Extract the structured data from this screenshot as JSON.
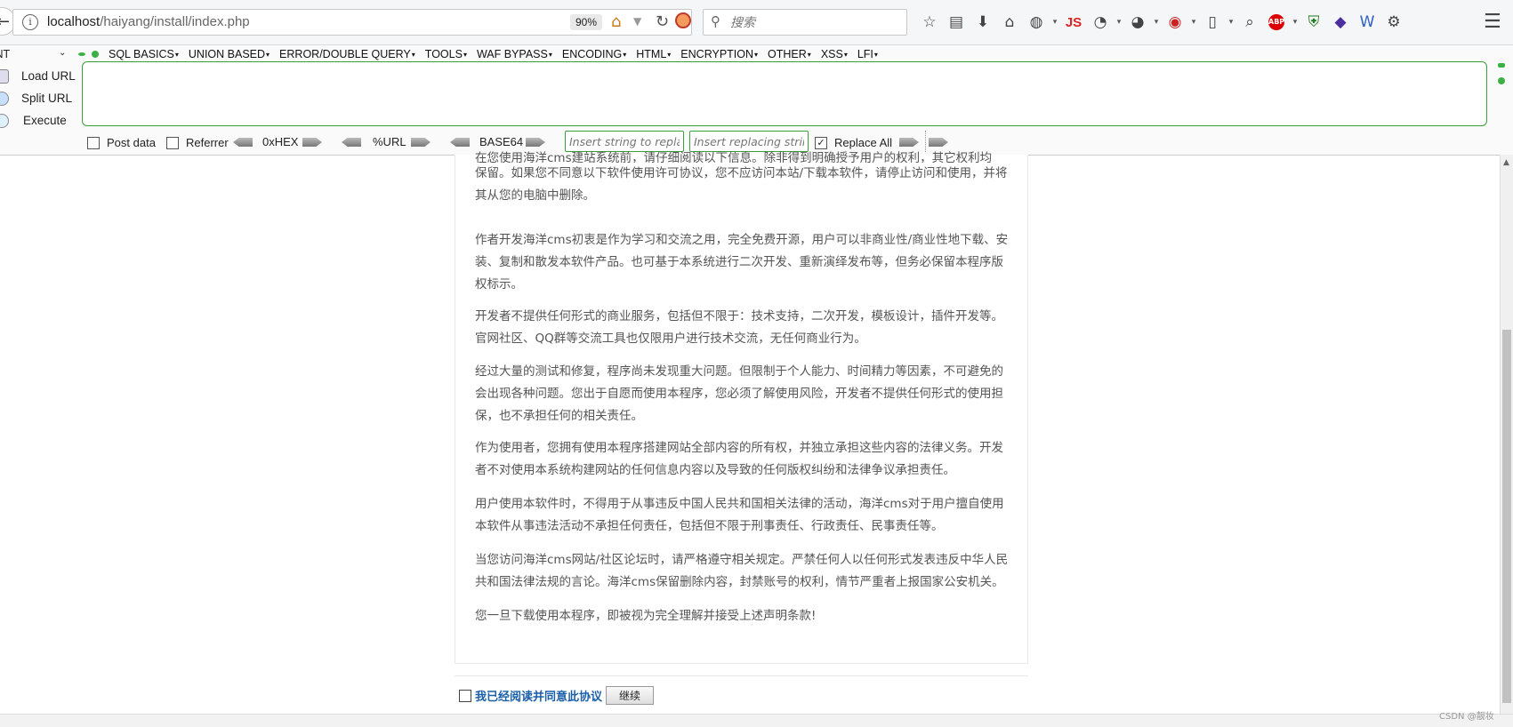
{
  "browser": {
    "url_host": "localhost",
    "url_path": "/haiyang/install/index.php",
    "zoom": "90%",
    "search_placeholder": "搜索",
    "toolbar_icons": [
      "star-icon",
      "reading-list-icon",
      "download-icon",
      "home-icon",
      "globe-icon",
      "js-icon",
      "translate-icon",
      "palette-icon",
      "record-icon",
      "device-icon",
      "zoom-icon",
      "adblock-icon",
      "shield-icon",
      "diamond-icon",
      "wappalyzer-icon",
      "gear-icon"
    ],
    "js_label": "JS",
    "abp_label": "ABP"
  },
  "hackbar": {
    "select_value": "INT",
    "menu": [
      "SQL BASICS",
      "UNION BASED",
      "ERROR/DOUBLE QUERY",
      "TOOLS",
      "WAF BYPASS",
      "ENCODING",
      "HTML",
      "ENCRYPTION",
      "OTHER",
      "XSS",
      "LFI"
    ],
    "load_url": "Load URL",
    "split_url": "Split URL",
    "execute": "Execute",
    "post_data": "Post data",
    "referrer": "Referrer",
    "hex": "0xHEX",
    "url_enc": "%URL",
    "base64": "BASE64",
    "insert_replace_placeholder": "Insert string to replace",
    "insert_replacing_placeholder": "Insert replacing string",
    "replace_all": "Replace All",
    "replace_all_checked": true
  },
  "page": {
    "cut_line": "在您使用海洋cms建站系统前，请仔细阅读以下信息。除非得到明确授予用户的权利，其它权利均",
    "paragraphs": [
      "保留。如果您不同意以下软件使用许可协议，您不应访问本站/下载本软件，请停止访问和使用，并将其从您的电脑中删除。",
      "作者开发海洋cms初衷是作为学习和交流之用，完全免费开源，用户可以非商业性/商业性地下载、安装、复制和散发本软件产品。也可基于本系统进行二次开发、重新演绎发布等，但务必保留本程序版权标示。",
      "开发者不提供任何形式的商业服务，包括但不限于：技术支持，二次开发，模板设计，插件开发等。官网社区、QQ群等交流工具也仅限用户进行技术交流，无任何商业行为。",
      "经过大量的测试和修复，程序尚未发现重大问题。但限制于个人能力、时间精力等因素，不可避免的会出现各种问题。您出于自愿而使用本程序，您必须了解使用风险，开发者不提供任何形式的使用担保，也不承担任何的相关责任。",
      "作为使用者，您拥有使用本程序搭建网站全部内容的所有权，并独立承担这些内容的法律义务。开发者不对使用本系统构建网站的任何信息内容以及导致的任何版权纠纷和法律争议承担责任。",
      "用户使用本软件时，不得用于从事违反中国人民共和国相关法律的活动，海洋cms对于用户擅自使用本软件从事违法活动不承担任何责任，包括但不限于刑事责任、行政责任、民事责任等。",
      "当您访问海洋cms网站/社区论坛时，请严格遵守相关规定。严禁任何人以任何形式发表违反中华人民共和国法律法规的言论。海洋cms保留删除内容，封禁账号的权利，情节严重者上报国家公安机关。",
      "您一旦下载使用本程序，即被视为完全理解并接受上述声明条款!"
    ],
    "agree_label": "我已经阅读并同意此协议",
    "continue_label": "继续"
  },
  "watermark": "CSDN @靓妆"
}
